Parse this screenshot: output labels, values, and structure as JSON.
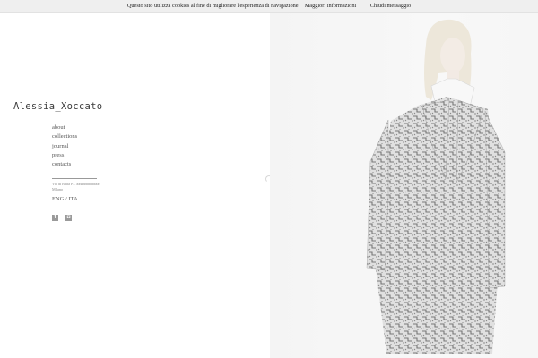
{
  "cookie_bar": {
    "message": "Questo sito utilizza cookies al fine di migliorare l'esperienza di navigazione.",
    "more_info": "Maggiori informazioni",
    "close": "Chiudi messaggio"
  },
  "brand": {
    "name": "Alessia_Xoccato"
  },
  "nav": {
    "items": [
      {
        "label": "about"
      },
      {
        "label": "collections"
      },
      {
        "label": "journal"
      },
      {
        "label": "press"
      },
      {
        "label": "contacts"
      }
    ]
  },
  "footer": {
    "address_line1": "Via di Baita P.I. ############",
    "address_line2": "Milano",
    "languages": "ENG / ITA"
  },
  "social": [
    {
      "icon": "facebook-icon",
      "glyph": "f"
    },
    {
      "icon": "instagram-icon",
      "glyph": "◘"
    }
  ],
  "colors": {
    "cookie_bar_bg": "#efefef",
    "coat_pattern": "#5a5a5a",
    "photo_bg": "#f4f4f4"
  }
}
